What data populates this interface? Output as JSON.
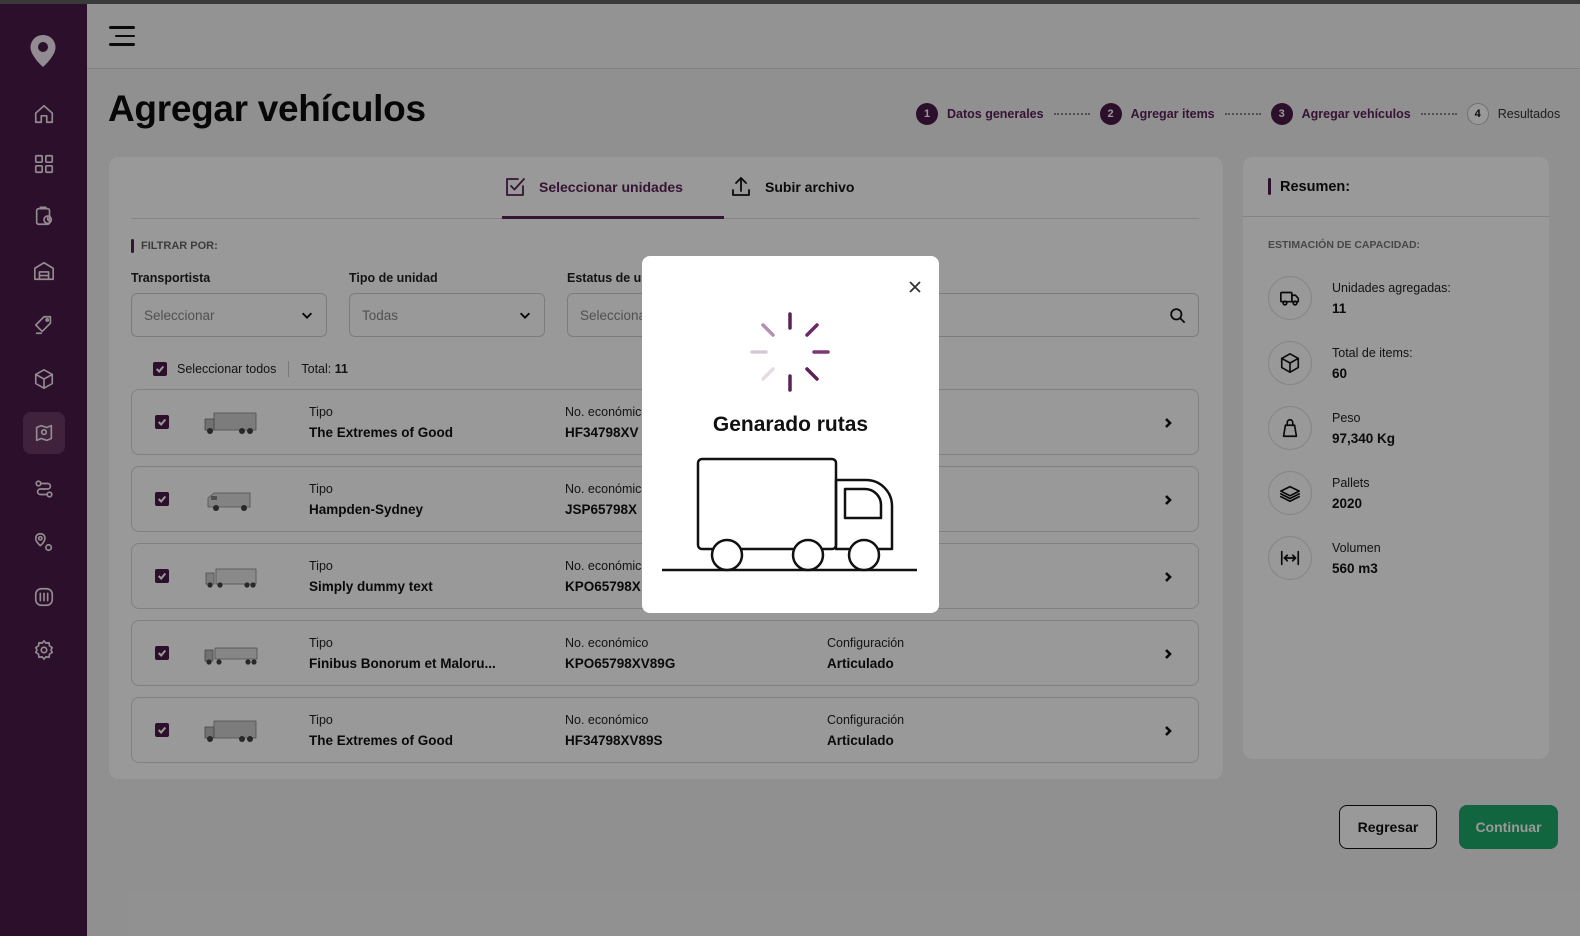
{
  "header": {
    "title": "Agregar vehículos"
  },
  "stepper": [
    {
      "num": "1",
      "label": "Datos generales",
      "state": "done"
    },
    {
      "num": "2",
      "label": "Agregar items",
      "state": "done"
    },
    {
      "num": "3",
      "label": "Agregar vehículos",
      "state": "active"
    },
    {
      "num": "4",
      "label": "Resultados",
      "state": "pending"
    }
  ],
  "tabs": {
    "select": "Seleccionar unidades",
    "upload": "Subir archivo"
  },
  "filters": {
    "title": "FILTRAR POR:",
    "carrier_label": "Transportista",
    "carrier_value": "Seleccionar",
    "unit_type_label": "Tipo de unidad",
    "unit_type_value": "Todas",
    "status_label": "Estatus de u",
    "status_value": "Selecciona"
  },
  "list": {
    "select_all": "Seleccionar todos",
    "total_label": "Total:",
    "total_value": "11",
    "rows": [
      {
        "type_label": "Tipo",
        "type": "The Extremes of Good",
        "eco_label": "No. económico",
        "eco": "HF34798XV",
        "config_label": "",
        "config": ""
      },
      {
        "type_label": "Tipo",
        "type": "Hampden-Sydney",
        "eco_label": "No. económico",
        "eco": "JSP65798X",
        "config_label": "",
        "config": ""
      },
      {
        "type_label": "Tipo",
        "type": "Simply dummy text",
        "eco_label": "No. económico",
        "eco": "KPO65798X",
        "config_label": "",
        "config": ""
      },
      {
        "type_label": "Tipo",
        "type": "Finibus Bonorum et Maloru...",
        "eco_label": "No. económico",
        "eco": "KPO65798XV89G",
        "config_label": "Configuración",
        "config": "Articulado"
      },
      {
        "type_label": "Tipo",
        "type": "The Extremes of Good",
        "eco_label": "No. económico",
        "eco": "HF34798XV89S",
        "config_label": "Configuración",
        "config": "Articulado"
      }
    ]
  },
  "summary": {
    "title": "Resumen:",
    "capacity_label": "ESTIMACIÓN DE CAPACIDAD:",
    "items": [
      {
        "icon": "truck-icon",
        "label": "Unidades agregadas:",
        "value": "11"
      },
      {
        "icon": "box-icon",
        "label": "Total de items:",
        "value": "60"
      },
      {
        "icon": "weight-icon",
        "label": "Peso",
        "value": "97,340 Kg"
      },
      {
        "icon": "pallets-icon",
        "label": "Pallets",
        "value": "2020"
      },
      {
        "icon": "volume-icon",
        "label": "Volumen",
        "value": "560 m3"
      }
    ]
  },
  "actions": {
    "back": "Regresar",
    "next": "Continuar"
  },
  "modal": {
    "title": "Genarado rutas"
  },
  "colors": {
    "brand": "#4a1a47",
    "accent": "#5a2256",
    "success": "#1da86a"
  }
}
